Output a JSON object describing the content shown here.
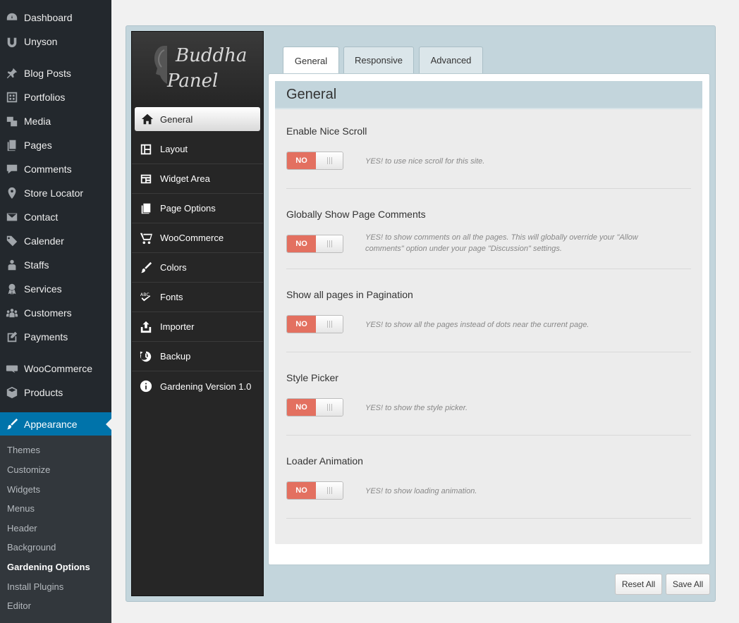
{
  "wp_menu": {
    "items": [
      {
        "label": "Dashboard",
        "icon": "dashboard-icon"
      },
      {
        "label": "Unyson",
        "icon": "unyson-icon"
      },
      {
        "label": "Blog Posts",
        "icon": "pin-icon"
      },
      {
        "label": "Portfolios",
        "icon": "portfolio-icon"
      },
      {
        "label": "Media",
        "icon": "media-icon"
      },
      {
        "label": "Pages",
        "icon": "pages-icon"
      },
      {
        "label": "Comments",
        "icon": "comments-icon"
      },
      {
        "label": "Store Locator",
        "icon": "location-icon"
      },
      {
        "label": "Contact",
        "icon": "mail-icon"
      },
      {
        "label": "Calender",
        "icon": "calendar-icon"
      },
      {
        "label": "Staffs",
        "icon": "staff-icon"
      },
      {
        "label": "Services",
        "icon": "award-icon"
      },
      {
        "label": "Customers",
        "icon": "groups-icon"
      },
      {
        "label": "Payments",
        "icon": "edit-icon"
      },
      {
        "label": "WooCommerce",
        "icon": "woocommerce-icon"
      },
      {
        "label": "Products",
        "icon": "products-icon"
      },
      {
        "label": "Appearance",
        "icon": "paintbrush-icon"
      }
    ],
    "submenu": [
      "Themes",
      "Customize",
      "Widgets",
      "Menus",
      "Header",
      "Background",
      "Gardening Options",
      "Install Plugins",
      "Editor"
    ],
    "active_item": "Appearance",
    "current_sub": "Gardening Options"
  },
  "panel": {
    "logo_line1": "Buddha",
    "logo_line2": "Panel",
    "nav": [
      {
        "label": "General",
        "icon": "home-icon"
      },
      {
        "label": "Layout",
        "icon": "layout-icon"
      },
      {
        "label": "Widget Area",
        "icon": "widget-area-icon"
      },
      {
        "label": "Page Options",
        "icon": "pages-icon"
      },
      {
        "label": "WooCommerce",
        "icon": "cart-icon"
      },
      {
        "label": "Colors",
        "icon": "paintbrush-icon"
      },
      {
        "label": "Fonts",
        "icon": "fonts-icon"
      },
      {
        "label": "Importer",
        "icon": "upload-icon"
      },
      {
        "label": "Backup",
        "icon": "backup-icon"
      },
      {
        "label": "Gardening Version 1.0",
        "icon": "info-icon"
      }
    ],
    "active_nav": "General"
  },
  "tabs": [
    "General",
    "Responsive",
    "Advanced"
  ],
  "active_tab": "General",
  "section_title": "General",
  "options": [
    {
      "title": "Enable Nice Scroll",
      "toggle": "NO",
      "desc": "YES! to use nice scroll for this site."
    },
    {
      "title": "Globally Show Page Comments",
      "toggle": "NO",
      "desc": "YES! to show comments on all the pages. This will globally override your \"Allow comments\" option under your page \"Discussion\" settings."
    },
    {
      "title": "Show all pages in Pagination",
      "toggle": "NO",
      "desc": "YES! to show all the pages instead of dots near the current page."
    },
    {
      "title": "Style Picker",
      "toggle": "NO",
      "desc": "YES! to show the style picker."
    },
    {
      "title": "Loader Animation",
      "toggle": "NO",
      "desc": "YES! to show loading animation."
    }
  ],
  "buttons": {
    "reset": "Reset All",
    "save": "Save All"
  },
  "colors": {
    "wp_sidebar": "#23282d",
    "wp_active": "#0073aa",
    "panel_bg": "#c3d5dc",
    "toggle_no": "#e37060"
  }
}
